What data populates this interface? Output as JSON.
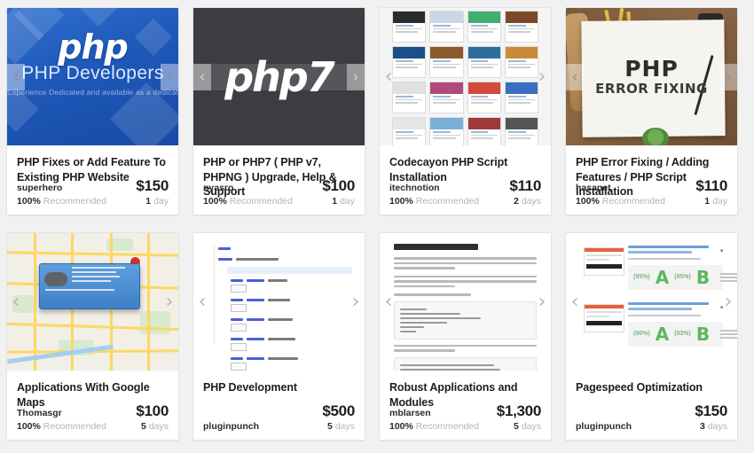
{
  "page": {
    "background": "#f1f1f1",
    "card_background": "#ffffff",
    "accent_price_color": "#1d1d1d",
    "muted_text_color": "#b4b4b4",
    "columns": 4,
    "rows": 2
  },
  "carousel": {
    "prev_icon": "chevron-left-icon",
    "next_icon": "chevron-right-icon",
    "prev_glyph": "‹",
    "next_glyph": "›"
  },
  "labels": {
    "recommended": "Recommended"
  },
  "cards": [
    {
      "id": "php-fixes",
      "title": "PHP Fixes or Add Feature To Existing PHP Website",
      "seller": "superhero",
      "price": "$150",
      "recommended_pct": "100%",
      "recommended_label": "Recommended",
      "delivery_count": "1",
      "delivery_unit": "day",
      "has_recommended": true,
      "thumb": {
        "kind": "php-developers-banner",
        "logo_text": "php",
        "caption": "PHP Developers",
        "subcaption": "Experience Dedicated and available as a dedicated resource",
        "bg_color": "#1e58b8"
      }
    },
    {
      "id": "php7-upgrade",
      "title": "PHP or PHP7 ( PHP v7, PHPNG ) Upgrade, Help & Support",
      "seller": "nyasro",
      "price": "$100",
      "recommended_pct": "100%",
      "recommended_label": "Recommended",
      "delivery_count": "1",
      "delivery_unit": "day",
      "has_recommended": true,
      "thumb": {
        "kind": "php7-dark",
        "logo_text": "php7",
        "bg_color": "#3b3d42"
      }
    },
    {
      "id": "codecanyon-install",
      "title": "Codecayon PHP Script Installation",
      "seller": "itechnotion",
      "price": "$110",
      "recommended_pct": "100%",
      "recommended_label": "Recommended",
      "delivery_count": "2",
      "delivery_unit": "days",
      "has_recommended": true,
      "thumb": {
        "kind": "thumbnail-grid",
        "bg_color": "#f4f4f4"
      }
    },
    {
      "id": "php-error-fixing",
      "title": "PHP Error Fixing / Adding Features / PHP Script Installation",
      "seller": "hasanet",
      "price": "$110",
      "recommended_pct": "100%",
      "recommended_label": "Recommended",
      "delivery_count": "1",
      "delivery_unit": "day",
      "has_recommended": true,
      "thumb": {
        "kind": "desk-photo",
        "line1": "PHP",
        "line2": "ERROR FIXING",
        "bg_color": "#8c6745"
      }
    },
    {
      "id": "google-maps-apps",
      "title": "Applications With Google Maps",
      "seller": "Thomasgr",
      "price": "$100",
      "recommended_pct": "100%",
      "recommended_label": "Recommended",
      "delivery_count": "5",
      "delivery_unit": "days",
      "has_recommended": true,
      "thumb": {
        "kind": "google-map",
        "bg_color": "#f2efe6"
      }
    },
    {
      "id": "php-development",
      "title": "PHP Development",
      "seller": "pluginpunch",
      "price": "$500",
      "recommended_pct": "",
      "recommended_label": "",
      "delivery_count": "5",
      "delivery_unit": "days",
      "has_recommended": false,
      "thumb": {
        "kind": "code-editor",
        "bg_color": "#ffffff"
      }
    },
    {
      "id": "robust-applications",
      "title": "Robust Applications and Modules",
      "seller": "mblarsen",
      "price": "$1,300",
      "recommended_pct": "100%",
      "recommended_label": "Recommended",
      "delivery_count": "5",
      "delivery_unit": "days",
      "has_recommended": true,
      "thumb": {
        "kind": "github-readme",
        "heading": "About this fork",
        "bg_color": "#ffffff"
      }
    },
    {
      "id": "pagespeed-optimization",
      "title": "Pagespeed Optimization",
      "seller": "pluginpunch",
      "price": "$150",
      "recommended_pct": "",
      "recommended_label": "",
      "delivery_count": "3",
      "delivery_unit": "days",
      "has_recommended": false,
      "thumb": {
        "kind": "performance-report",
        "grade_a": "A",
        "grade_b": "B",
        "pct_a": "(95%)",
        "pct_b": "(85%)",
        "grade_a2": "A",
        "grade_b2": "B",
        "pct_a2": "(90%)",
        "pct_b2": "(83%)",
        "bg_color": "#ffffff"
      }
    }
  ]
}
